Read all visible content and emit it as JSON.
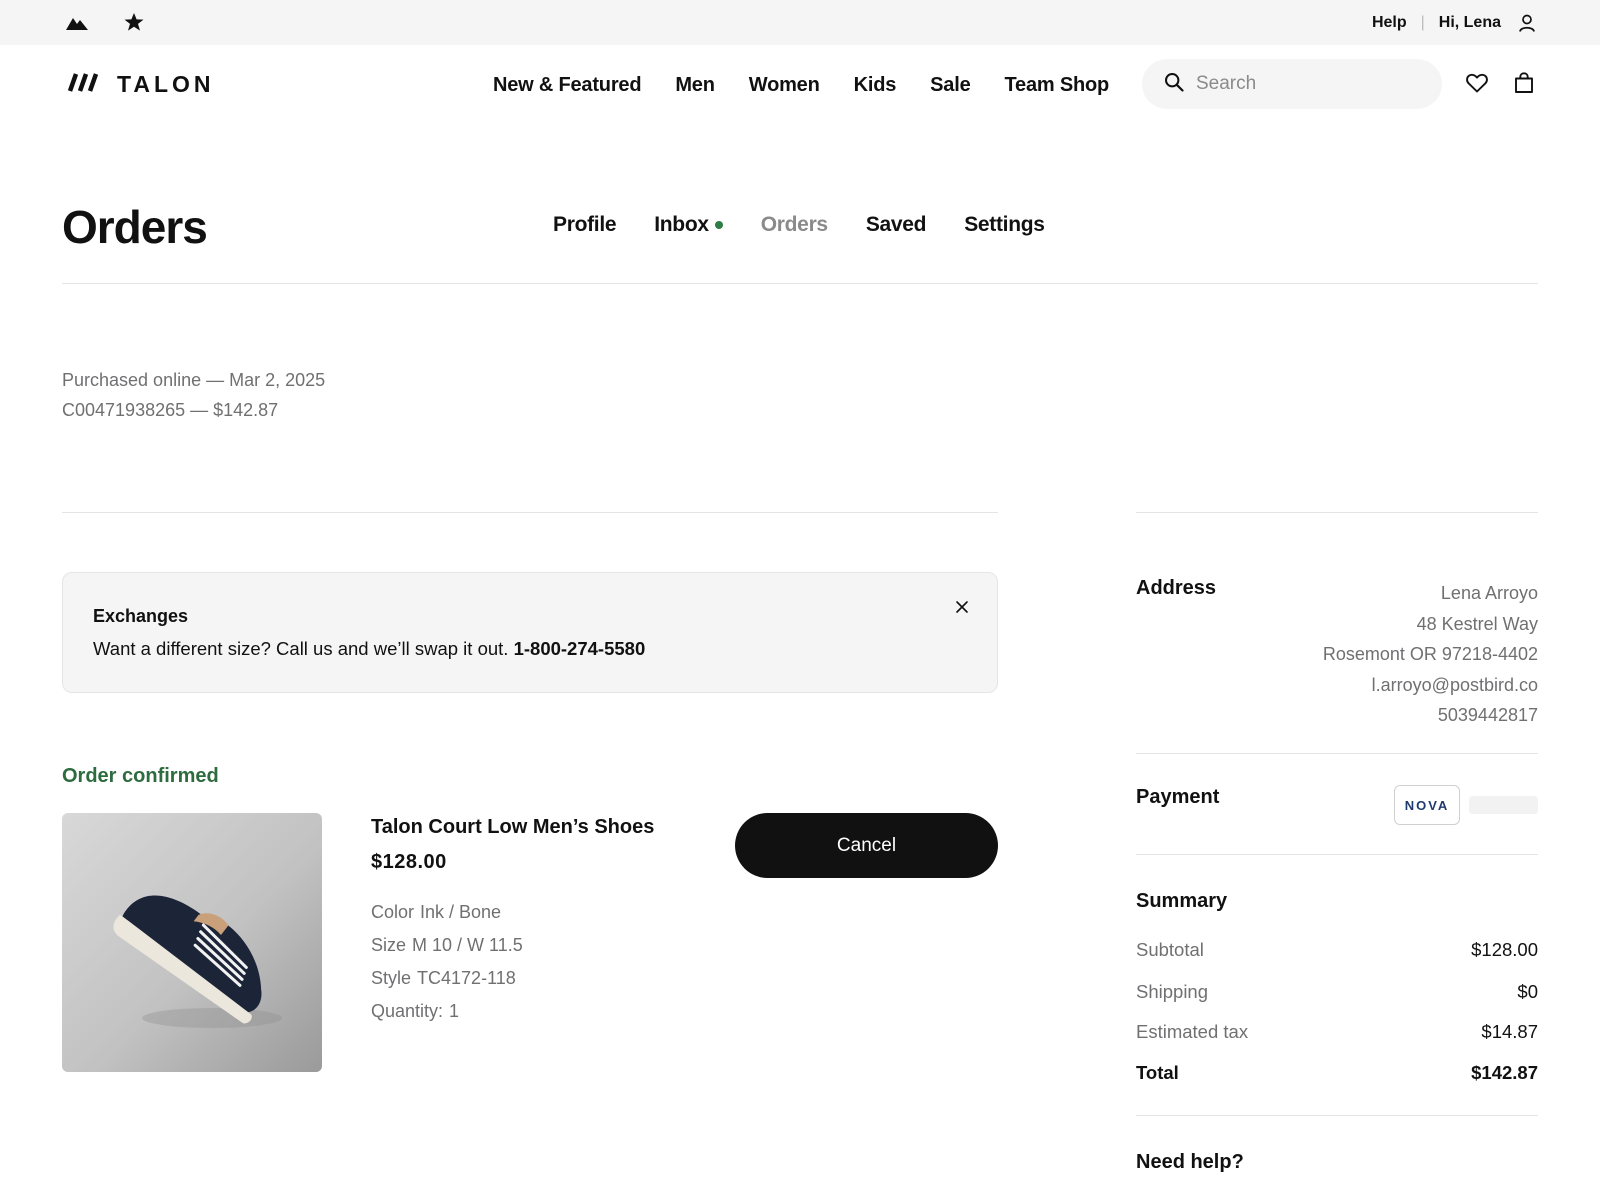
{
  "utility_bar": {
    "help_label": "Help",
    "divider": "|",
    "greeting": "Hi, Lena"
  },
  "header": {
    "logo_text": "TALON",
    "nav": [
      "New & Featured",
      "Men",
      "Women",
      "Kids",
      "Sale",
      "Team Shop"
    ],
    "search_placeholder": "Search"
  },
  "account": {
    "page_title": "Orders",
    "tabs": [
      "Profile",
      "Inbox",
      "Orders",
      "Saved",
      "Settings"
    ],
    "active_tab": "Orders"
  },
  "order": {
    "purchase_line": "Purchased online — Mar 2, 2025",
    "id_line": "C00471938265 — $142.87"
  },
  "banner": {
    "title": "Exchanges",
    "text": "Want a different size? Call us and we’ll swap it out.",
    "phone": "1-800-274-5580"
  },
  "product": {
    "status": "Order confirmed",
    "name": "Talon Court Low Men’s Shoes",
    "price": "$128.00",
    "color_label": "Color",
    "color_value": "Ink / Bone",
    "size_label": "Size",
    "size_value": "M 10 / W 11.5",
    "style_label": "Style",
    "style_value": "TC4172-118",
    "quantity_label": "Quantity:",
    "quantity_value": "1",
    "cancel_label": "Cancel"
  },
  "address": {
    "label": "Address",
    "lines": [
      "Lena Arroyo",
      "48 Kestrel Way",
      "Rosemont OR 97218-4402",
      "l.arroyo@postbird.co",
      "5039442817"
    ]
  },
  "payment": {
    "label": "Payment",
    "card_brand": "NOVA"
  },
  "summary": {
    "label": "Summary",
    "subtotal_label": "Subtotal",
    "subtotal": "$128.00",
    "shipping_label": "Shipping",
    "shipping": "$0",
    "tax_label": "Estimated tax",
    "tax": "$14.87",
    "total_label": "Total",
    "total": "$142.87"
  },
  "help": {
    "label": "Need help?"
  },
  "colors": {
    "accent_green": "#2e6b3f",
    "inbox_dot": "#2e7d46",
    "text_primary": "#111111",
    "text_secondary": "#707072",
    "button_dark": "#111111",
    "utility_bg": "#f5f5f5",
    "card_brand": "#1e3a6e"
  },
  "icons": [
    "mountain-brand-icon",
    "star-brand-icon",
    "account-icon",
    "search-icon",
    "heart-icon",
    "bag-icon",
    "close-icon",
    "talon-logo-icon"
  ]
}
